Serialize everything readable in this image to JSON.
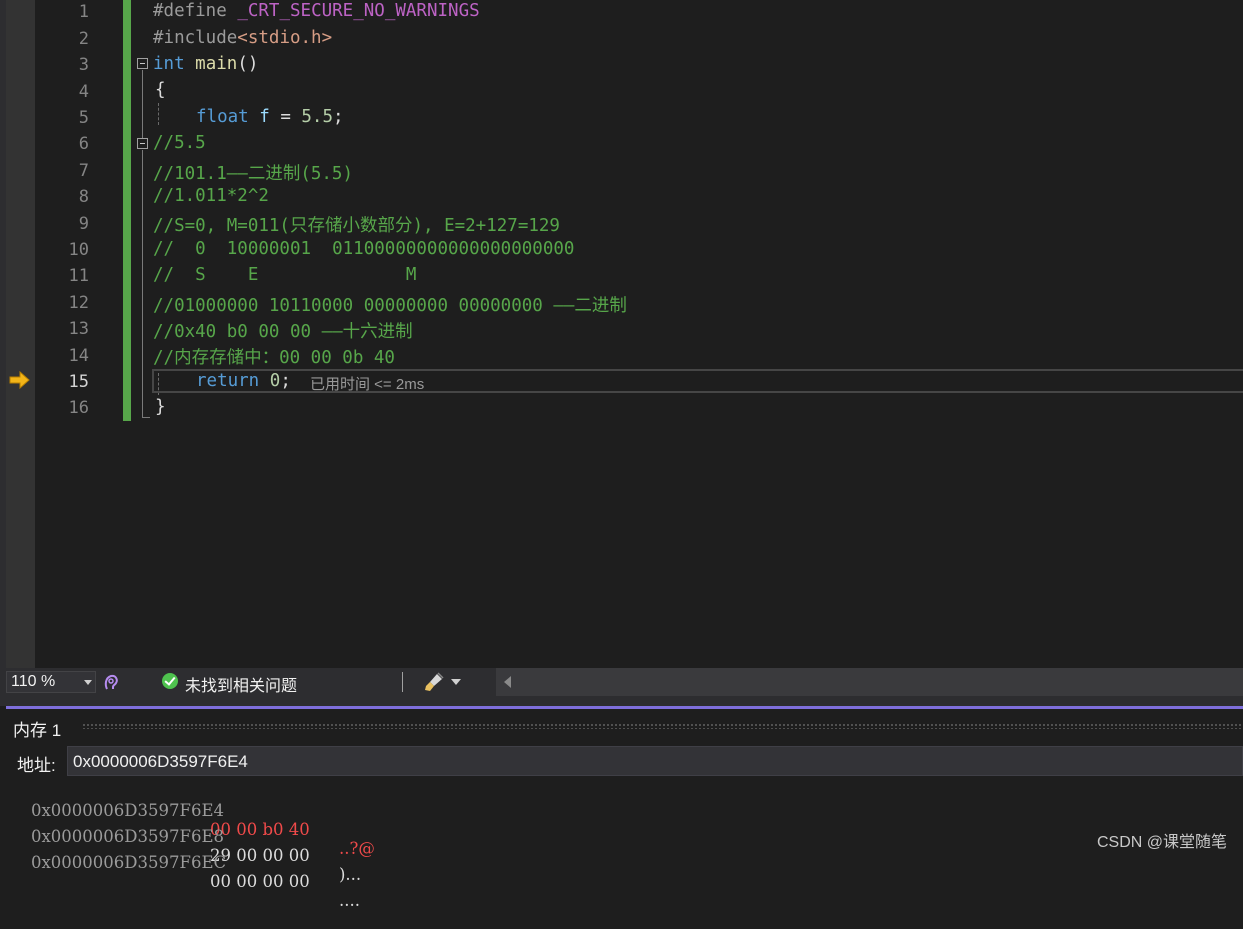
{
  "editor": {
    "current_line": 15,
    "line_numbers": [
      "1",
      "2",
      "3",
      "4",
      "5",
      "6",
      "7",
      "8",
      "9",
      "10",
      "11",
      "12",
      "13",
      "14",
      "15",
      "16"
    ],
    "line1": {
      "directive": "#define",
      "macro": "_CRT_SECURE_NO_WARNINGS"
    },
    "line2": {
      "directive": "#include",
      "header": "<stdio.h>"
    },
    "line3": {
      "kw": "int",
      "fn": "main",
      "rest": "()"
    },
    "line4": {
      "text": "{"
    },
    "line5": {
      "kw": "float",
      "var": "f",
      "op": " = ",
      "num": "5.5",
      "semi": ";"
    },
    "line6": {
      "comment": "//5.5"
    },
    "line7": {
      "comment": "//101.1——二进制(5.5)"
    },
    "line8": {
      "comment": "//1.011*2^2"
    },
    "line9": {
      "comment": "//S=0, M=011(只存储小数部分), E=2+127=129"
    },
    "line10": {
      "comment": "//  0  10000001  01100000000000000000000"
    },
    "line11": {
      "comment": "//  S    E              M"
    },
    "line12": {
      "comment": "//01000000 10110000 00000000 00000000 ——二进制"
    },
    "line13": {
      "comment": "//0x40 b0 00 00 ——十六进制"
    },
    "line14": {
      "comment": "//内存存储中：00 00 0b 40"
    },
    "line15": {
      "kw": "return",
      "num": "0",
      "semi": ";",
      "elapsed": "已用时间 <= 2ms"
    },
    "line16": {
      "text": "}"
    }
  },
  "statusbar": {
    "zoom": "110 %",
    "issues": "未找到相关问题"
  },
  "memory": {
    "title": "内存 1",
    "address_label": "地址:",
    "address_value": "0x0000006D3597F6E4",
    "rows": [
      {
        "addr": "0x0000006D3597F6E4",
        "bytes": "00 00 b0 40",
        "ascii": "..?@",
        "changed": true
      },
      {
        "addr": "0x0000006D3597F6E8",
        "bytes": "29 00 00 00",
        "ascii": ")...",
        "changed": false
      },
      {
        "addr": "0x0000006D3597F6EC",
        "bytes": "00 00 00 00",
        "ascii": "....",
        "changed": false
      }
    ]
  },
  "watermark": "CSDN @课堂随笔",
  "colors": {
    "comment": "#57a64a",
    "keyword": "#569cd6",
    "function": "#dcdcaa",
    "number": "#b5cea8",
    "changed_memory": "#f04a4a",
    "memory_accent": "#7f6fdc"
  },
  "icons": [
    "current-statement-arrow-icon",
    "collapse-icon",
    "code-cleanup-brush-icon",
    "ok-check-icon",
    "scroll-left-icon"
  ]
}
